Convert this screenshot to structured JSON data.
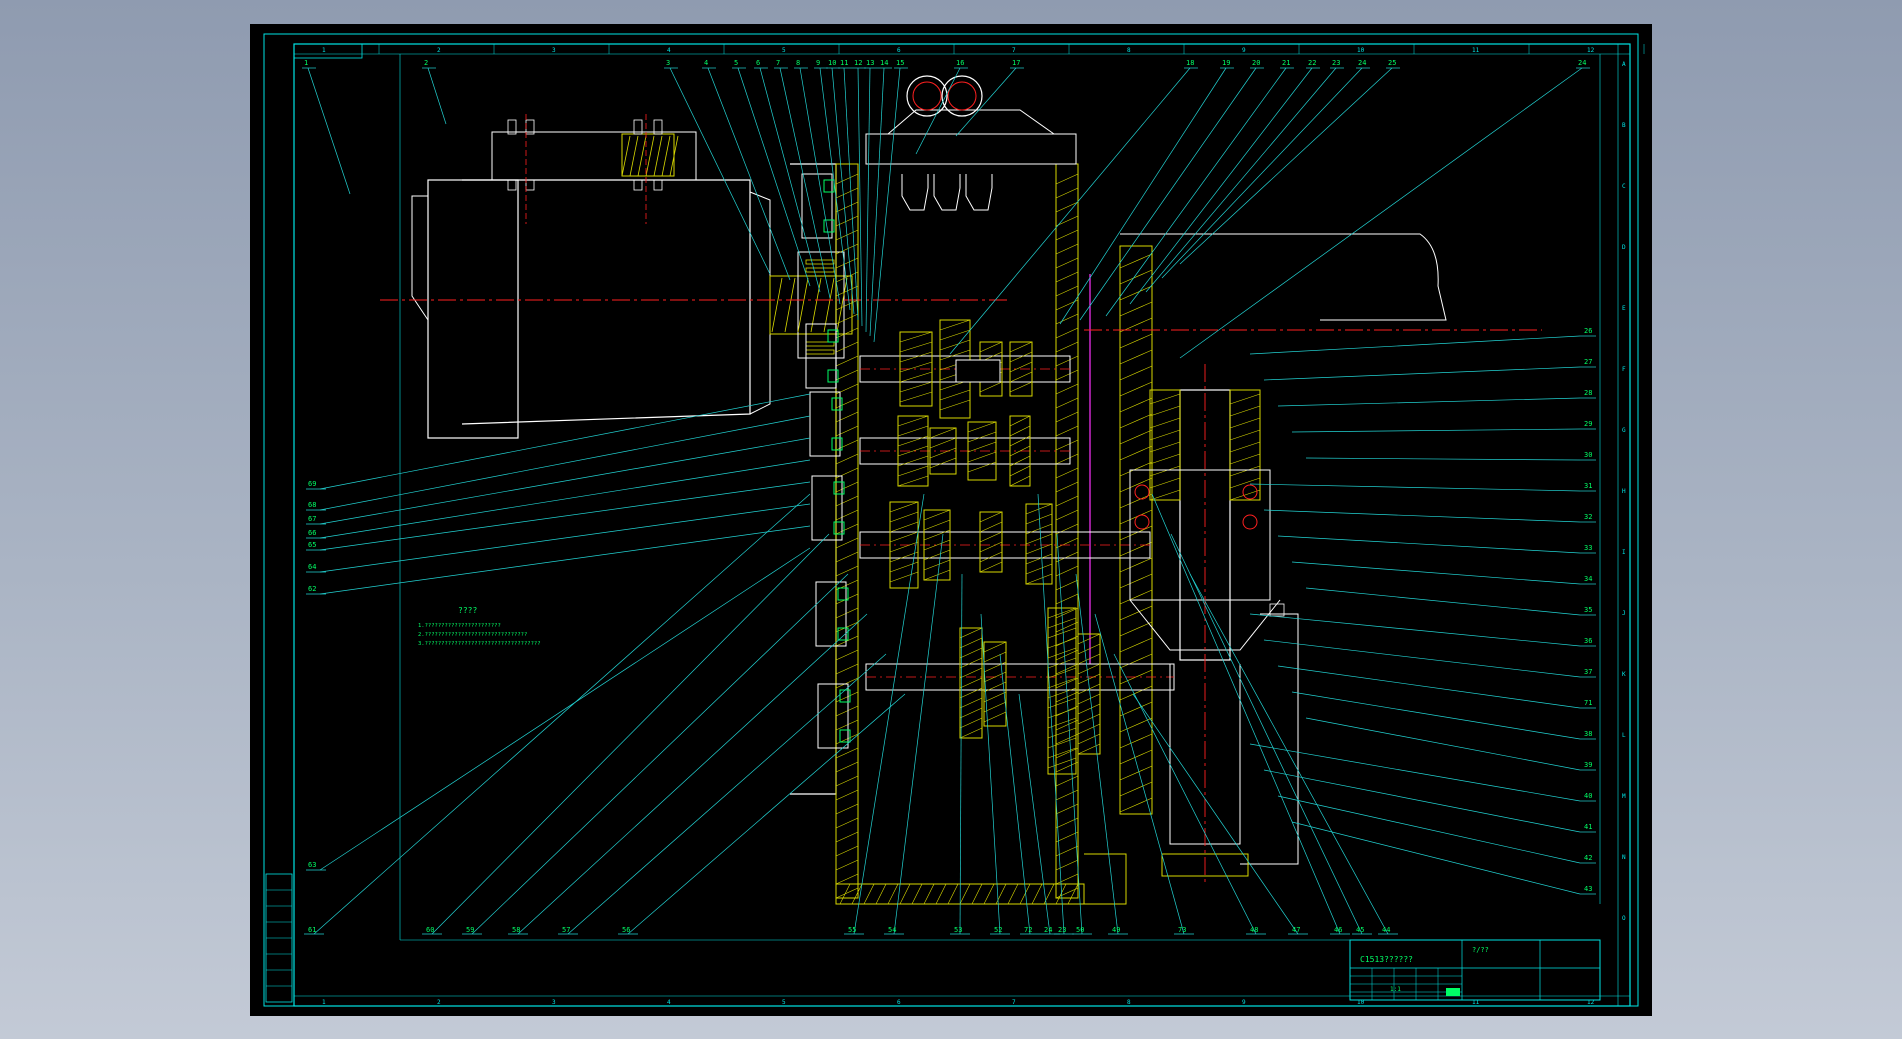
{
  "drawing": {
    "colors": {
      "background": "#000000",
      "frame": "#00e5e5",
      "leader": "#22d3d3",
      "outline": "#ffffff",
      "section": "#d8d800",
      "centerline": "#ff2020",
      "label": "#00ff66",
      "accent": "#ff33ff"
    },
    "grid": {
      "top_numbers": [
        "1",
        "2",
        "3",
        "4",
        "5",
        "6",
        "7",
        "8",
        "9",
        "10",
        "11",
        "12"
      ],
      "bottom_numbers": [
        "1",
        "2",
        "3",
        "4",
        "5",
        "6",
        "7",
        "8",
        "9",
        "10",
        "11",
        "12"
      ],
      "side_letters": [
        "A",
        "B",
        "C",
        "D",
        "E",
        "F",
        "G",
        "H",
        "I",
        "J",
        "K",
        "L",
        "M",
        "N",
        "O"
      ]
    },
    "top_labels": [
      "1",
      "2",
      "3",
      "4",
      "5",
      "6",
      "7",
      "8",
      "9",
      "10",
      "11",
      "12",
      "13",
      "14",
      "15",
      "16",
      "17",
      "18",
      "19",
      "20",
      "21",
      "22",
      "23",
      "24",
      "25",
      "24"
    ],
    "right_labels": [
      "26",
      "27",
      "28",
      "29",
      "30",
      "31",
      "32",
      "33",
      "34",
      "35",
      "36",
      "37",
      "71",
      "38",
      "39",
      "40",
      "41",
      "42",
      "43"
    ],
    "bottom_labels": [
      "61",
      "60",
      "59",
      "58",
      "57",
      "56",
      "55",
      "54",
      "53",
      "52",
      "72",
      "24",
      "23",
      "50",
      "49",
      "73",
      "48",
      "47",
      "46",
      "45",
      "44"
    ],
    "left_labels": [
      "69",
      "68",
      "67",
      "66",
      "65",
      "64",
      "62",
      "63"
    ],
    "notes": {
      "title": "????",
      "lines": [
        "1.???????????????????????",
        "2.???????????????????????????????",
        "3.???????????????????????????????????"
      ]
    },
    "title_block": {
      "name": "C1513??????",
      "drawing_no": "?/??",
      "scale": "1:1"
    }
  }
}
